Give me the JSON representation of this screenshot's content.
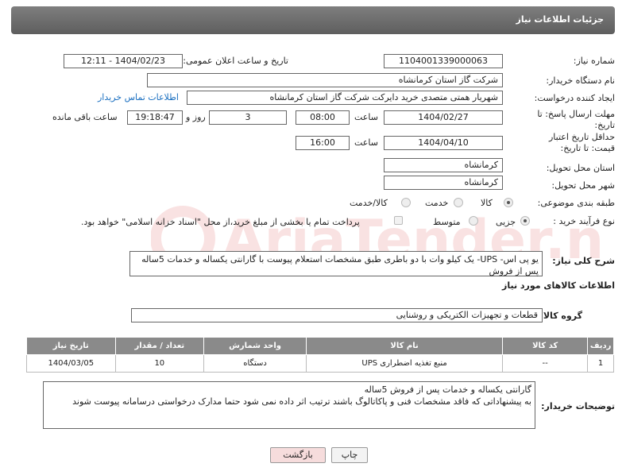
{
  "header": {
    "title": "جزئیات اطلاعات نیاز"
  },
  "need_number": {
    "label": "شماره نیاز:",
    "value": "1104001339000063"
  },
  "announce": {
    "label": "تاریخ و ساعت اعلان عمومی:",
    "value": "1404/02/23 - 12:11"
  },
  "buyer_org": {
    "label": "نام دستگاه خریدار:",
    "value": "شرکت گاز استان کرمانشاه"
  },
  "creator": {
    "label": "ایجاد کننده درخواست:",
    "value": "شهریار همتی متصدی خرید دایرکت شرکت گاز استان کرمانشاه",
    "contact_link": "اطلاعات تماس خریدار"
  },
  "deadline": {
    "label": "مهلت ارسال پاسخ: تا تاریخ:",
    "date": "1404/02/27",
    "time_label": "ساعت",
    "time": "08:00",
    "days": "3",
    "days_label": "روز و",
    "remaining": "19:18:47",
    "remaining_label": "ساعت باقی مانده"
  },
  "validity": {
    "label": "حداقل تاریخ اعتبار قیمت: تا تاریخ:",
    "date": "1404/04/10",
    "time_label": "ساعت",
    "time": "16:00"
  },
  "province": {
    "label": "استان محل تحویل:",
    "value": "کرمانشاه"
  },
  "city": {
    "label": "شهر محل تحویل:",
    "value": "کرمانشاه"
  },
  "category": {
    "label": "طبقه بندی موضوعی:",
    "options": [
      "کالا",
      "خدمت",
      "کالا/خدمت"
    ],
    "selected": "کالا"
  },
  "process": {
    "label": "نوع فرآیند خرید :",
    "options": [
      "جزیی",
      "متوسط"
    ],
    "selected": "جزیی",
    "note": "پرداخت تمام یا بخشی از مبلغ خرید،از محل \"اسناد خزانه اسلامی\" خواهد بود."
  },
  "description": {
    "label": "شرح کلی نیاز:",
    "text": "یو پی اس- UPS- یک کیلو وات با دو باطری  طبق مشخصات استعلام پیوست با گارانتی یکساله و خدمات 5ساله پس از فروش"
  },
  "goods_section": {
    "title": "اطلاعات کالاهای مورد نیاز"
  },
  "goods_group": {
    "label": "گروه کالا:",
    "value": "قطعات و تجهیزات الکتریکی و روشنایی"
  },
  "table": {
    "headers": [
      "ردیف",
      "کد کالا",
      "نام کالا",
      "واحد شمارش",
      "تعداد / مقدار",
      "تاریخ نیاز"
    ],
    "rows": [
      [
        "1",
        "--",
        "منبع تغذیه اضطراری UPS",
        "دستگاه",
        "10",
        "1404/03/05"
      ]
    ]
  },
  "buyer_notes": {
    "label": "توضیحات خریدار:",
    "line1": "گارانتی یکساله و خدمات پس از فروش 5ساله",
    "line2": "به پیشنهاداتی که فاقد مشخصات فنی و پاکاتالوگ باشند ترتیب اثر داده نمی شود حتما مدارک درخواستی درسامانه پیوست شوند"
  },
  "buttons": {
    "print": "چاپ",
    "back": "بازگشت"
  },
  "watermark": {
    "text": "AriaTender.neT"
  }
}
